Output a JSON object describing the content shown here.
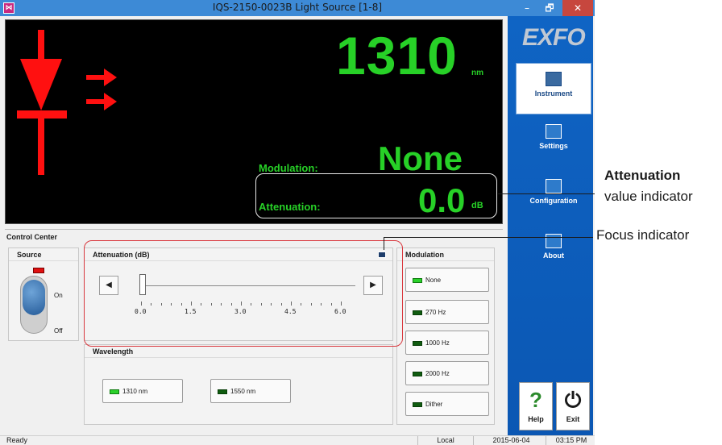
{
  "window": {
    "title": "IQS-2150-0023B Light Source [1-8]",
    "app_icon": "ex-icon",
    "minimize": "–",
    "maximize": "🗗",
    "close": "✕"
  },
  "display": {
    "wavelength_value": "1310",
    "wavelength_unit": "nm",
    "modulation_label": "Modulation:",
    "modulation_value": "None",
    "attenuation_label": "Attenuation:",
    "attenuation_value": "0.0",
    "attenuation_unit": "dB"
  },
  "control_center": {
    "title": "Control Center",
    "source": {
      "title": "Source",
      "on_label": "On",
      "off_label": "Off"
    },
    "attenuation": {
      "title": "Attenuation (dB)",
      "tick_labels": [
        "0.0",
        "1.5",
        "3.0",
        "4.5",
        "6.0"
      ],
      "value_fraction": 0.0,
      "left_arrow": "◀",
      "right_arrow": "▶"
    },
    "wavelength": {
      "title": "Wavelength",
      "options": [
        "1310 nm",
        "1550 nm"
      ]
    },
    "modulation": {
      "title": "Modulation",
      "options": [
        "None",
        "270 Hz",
        "1000 Hz",
        "2000 Hz",
        "Dither"
      ]
    }
  },
  "sidebar": {
    "logo": "EXFO",
    "nav": [
      "Instrument",
      "Settings",
      "Configuration",
      "About"
    ],
    "help": "Help",
    "exit": "Exit"
  },
  "statusbar": {
    "status": "Ready",
    "mode": "Local",
    "date": "2015-06-04",
    "time": "03:15 PM"
  },
  "annotations": {
    "attenuation_title": "Attenuation",
    "attenuation_sub": "value indicator",
    "focus": "Focus indicator"
  },
  "colors": {
    "display_green": "#27d127",
    "diode_red": "#ff1010",
    "sidebar_blue": "#0f64c4",
    "callout_red": "#d9393f"
  }
}
